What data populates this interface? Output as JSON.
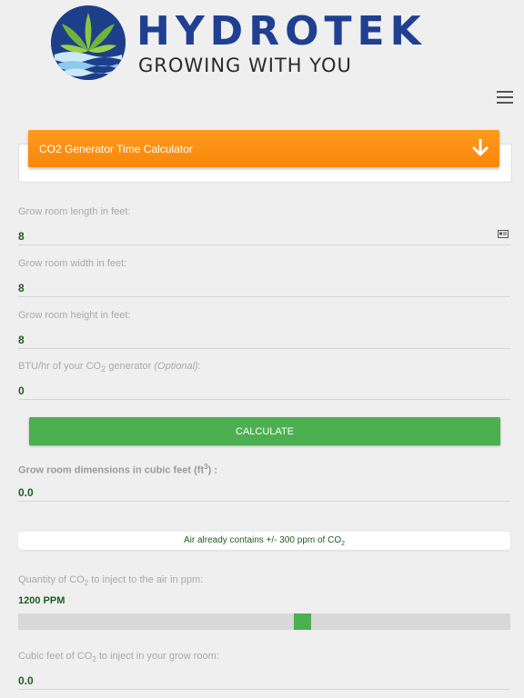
{
  "header": {
    "brand": "HYDROTEK",
    "tagline": "GROWING WITH YOU",
    "logo_icon": "hydrotek-leaf-logo",
    "menu_icon": "hamburger-menu-icon"
  },
  "calculator": {
    "title": "CO2 Generator Time Calculator",
    "toggle_icon": "arrow-down-icon"
  },
  "fields": {
    "length": {
      "label": "Grow room length in feet:",
      "value": "8"
    },
    "width": {
      "label": "Grow room width in feet:",
      "value": "8"
    },
    "height": {
      "label": "Grow room height in feet:",
      "value": "8"
    },
    "btu": {
      "label_pre": "BTU/hr of your CO",
      "label_sub": "2",
      "label_post": " generator ",
      "label_optional": "(Optional)",
      "label_end": ":",
      "value": "0"
    }
  },
  "calculate_label": "CALCULATE",
  "dimensions": {
    "label_pre": "Grow room dimensions in cubic feet (ft",
    "label_sup": "3",
    "label_post": ") :",
    "value": "0.0"
  },
  "air_info": {
    "text_pre": "Air already contains +/- 300 ppm of CO",
    "text_sub": "2"
  },
  "quantity": {
    "label_pre": "Quantity of CO",
    "label_sub": "2",
    "label_post": " to inject to the air in ppm:",
    "value": "1200 PPM",
    "slider_fraction": 0.58
  },
  "cubic_feet": {
    "label_pre": "Cubic feet of CO",
    "label_sub": "2",
    "label_post": " to inject in your grow room:",
    "value": "0.0"
  },
  "colors": {
    "accent_orange": "#f7870a",
    "green": "#4caf50",
    "value_green": "#1f5e21",
    "brand_blue": "#1f3f91"
  }
}
